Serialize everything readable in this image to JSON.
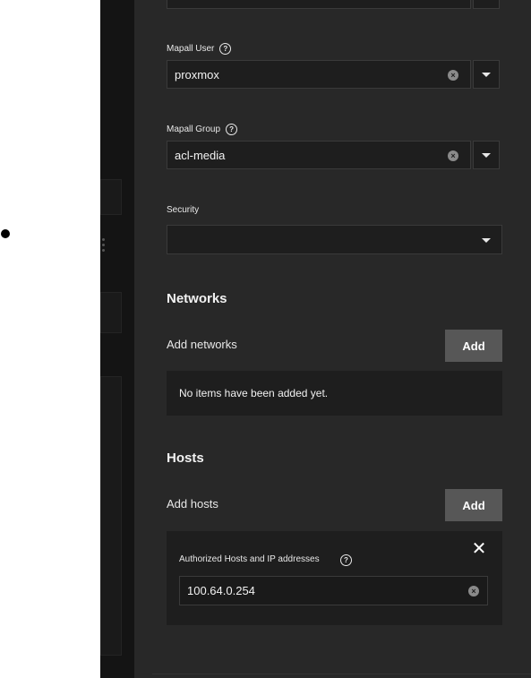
{
  "mapall_user": {
    "label": "Mapall User",
    "help_icon": "help-circle-icon",
    "value": "proxmox",
    "clear_icon": "clear-icon",
    "dropdown_icon": "chevron-down-icon"
  },
  "mapall_group": {
    "label": "Mapall Group",
    "help_icon": "help-circle-icon",
    "value": "acl-media",
    "clear_icon": "clear-icon",
    "dropdown_icon": "chevron-down-icon"
  },
  "security": {
    "label": "Security",
    "value": ""
  },
  "networks": {
    "title": "Networks",
    "add_label": "Add networks",
    "add_button": "Add",
    "empty_message": "No items have been added yet."
  },
  "hosts": {
    "title": "Hosts",
    "add_label": "Add hosts",
    "add_button": "Add",
    "items": [
      {
        "label": "Authorized Hosts and IP addresses",
        "value": "100.64.0.254",
        "remove_icon": "close-icon"
      }
    ]
  },
  "colors": {
    "panel_bg": "#282828",
    "field_bg": "#1e1e1e",
    "button_bg": "#575757",
    "text": "#f2f2f2"
  }
}
